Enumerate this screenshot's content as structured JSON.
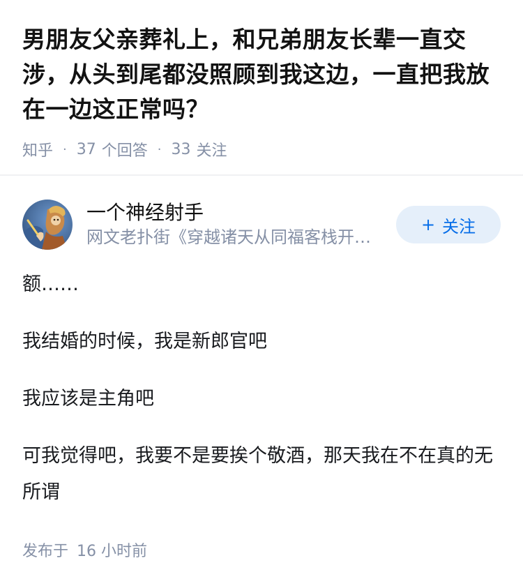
{
  "question": {
    "title": "男朋友父亲葬礼上，和兄弟朋友长辈一直交涉，从头到尾都没照顾到我这边，一直把我放在一边这正常吗？",
    "source": "知乎",
    "answers_count": "37",
    "answers_label": "个回答",
    "follows_count": "33",
    "follows_label": "关注",
    "separator": "·"
  },
  "answer": {
    "author_name": "一个神经射手",
    "author_bio": "网文老扑街《穿越诸天从同福客栈开始》",
    "follow_plus": "+",
    "follow_label": "关注",
    "avatar_icon": "avatar-icon",
    "paragraphs": [
      "额……",
      "我结婚的时候，我是新郎官吧",
      "我应该是主角吧",
      "可我觉得吧，我要不是要挨个敬酒，那天我在不在真的无所谓"
    ],
    "published_label": "发布于",
    "published_time": "16 小时前"
  },
  "colors": {
    "accent": "#056de8",
    "accent_bg": "#e5effa",
    "meta_text": "#8590a6",
    "title_text": "#121212"
  }
}
